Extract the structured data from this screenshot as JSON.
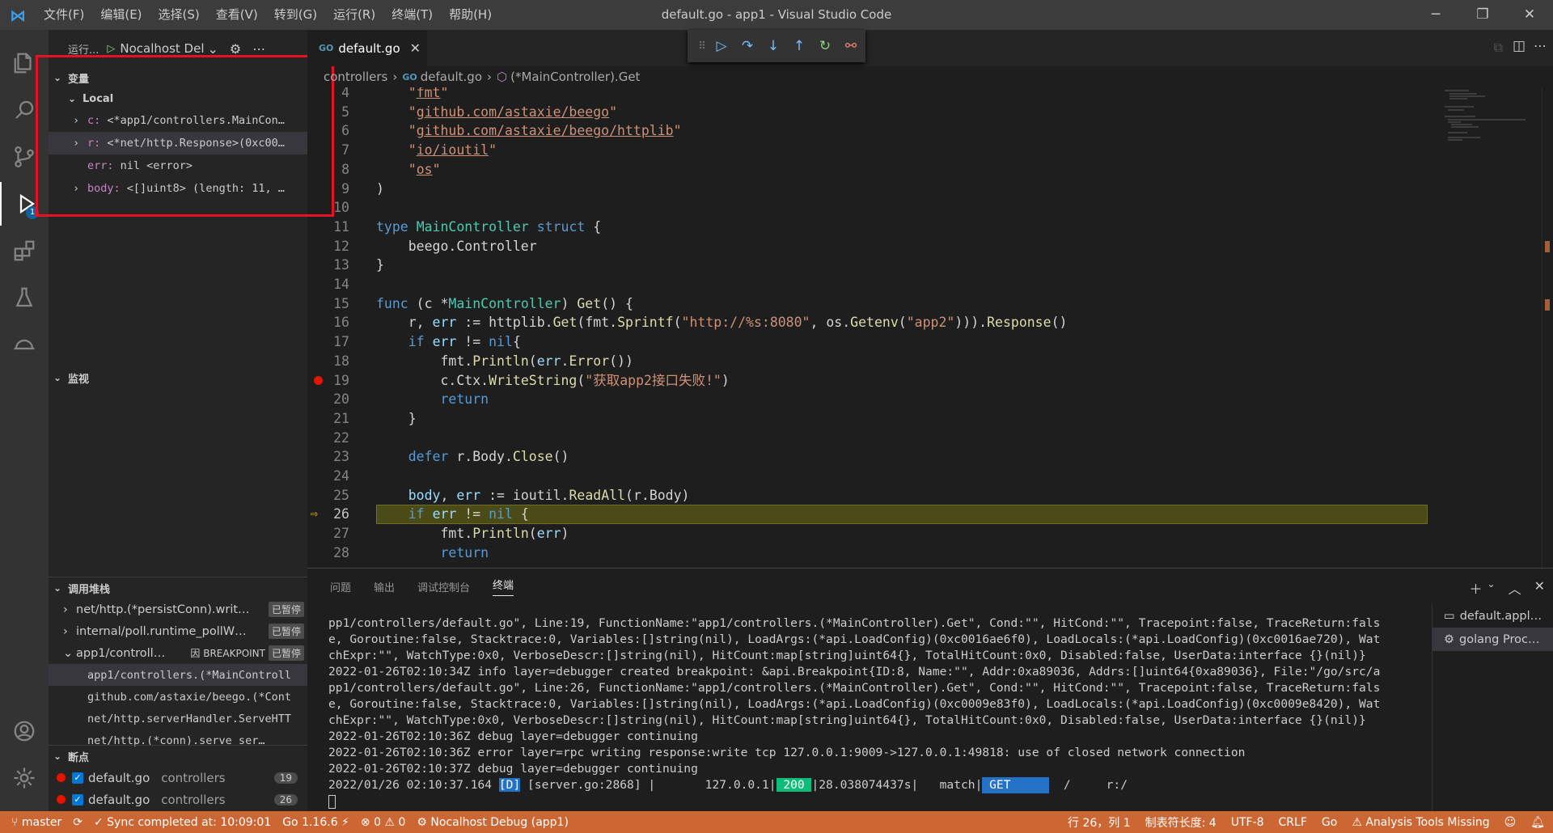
{
  "window": {
    "title": "default.go - app1 - Visual Studio Code",
    "menu": [
      "文件(F)",
      "编辑(E)",
      "选择(S)",
      "查看(V)",
      "转到(G)",
      "运行(R)",
      "终端(T)",
      "帮助(H)"
    ]
  },
  "activity": {
    "debug_badge": "1"
  },
  "debug_toolbar": {
    "run_label": "运行...",
    "config": "Nocalhost Del"
  },
  "variables": {
    "section_title": "变量",
    "scope": "Local",
    "items": [
      {
        "name": "c:",
        "value": "<*app1/controllers.MainCon…"
      },
      {
        "name": "r:",
        "value": "<*net/http.Response>(0xc00…"
      },
      {
        "name": "err:",
        "value": "nil <error>"
      },
      {
        "name": "body:",
        "value": "<[]uint8> (length: 11, …"
      }
    ]
  },
  "watch": {
    "section_title": "监视"
  },
  "callstack": {
    "section_title": "调用堆栈",
    "threads": [
      {
        "label": "net/http.(*persistConn).writ…",
        "status": "已暂停"
      },
      {
        "label": "internal/poll.runtime_pollW…",
        "status": "已暂停"
      },
      {
        "label": "app1/controll…",
        "reason": "因 BREAKPOINT",
        "status": "已暂停"
      }
    ],
    "frames": [
      "app1/controllers.(*MainControll",
      "github.com/astaxie/beego.(*Cont",
      "net/http.serverHandler.ServeHTT",
      "net/http.(*conn).serve   ser…"
    ]
  },
  "breakpoints": {
    "section_title": "断点",
    "items": [
      {
        "file": "default.go",
        "dir": "controllers",
        "line": "19"
      },
      {
        "file": "default.go",
        "dir": "controllers",
        "line": "26"
      }
    ]
  },
  "editor": {
    "tab": "default.go",
    "breadcrumb": {
      "folder": "controllers",
      "file": "default.go",
      "symbol": "(*MainController).Get"
    },
    "lines": [
      {
        "n": "4",
        "code": "    \"fmt\""
      },
      {
        "n": "5",
        "code": "    \"github.com/astaxie/beego\""
      },
      {
        "n": "6",
        "code": "    \"github.com/astaxie/beego/httplib\""
      },
      {
        "n": "7",
        "code": "    \"io/ioutil\""
      },
      {
        "n": "8",
        "code": "    \"os\""
      },
      {
        "n": "9",
        "code": ")"
      },
      {
        "n": "10",
        "code": ""
      },
      {
        "n": "11",
        "code": "type MainController struct {"
      },
      {
        "n": "12",
        "code": "    beego.Controller"
      },
      {
        "n": "13",
        "code": "}"
      },
      {
        "n": "14",
        "code": ""
      },
      {
        "n": "15",
        "code": "func (c *MainController) Get() {"
      },
      {
        "n": "16",
        "code": "    r, err := httplib.Get(fmt.Sprintf(\"http://%s:8080\", os.Getenv(\"app2\"))).Response()"
      },
      {
        "n": "17",
        "code": "    if err != nil{"
      },
      {
        "n": "18",
        "code": "        fmt.Println(err.Error())"
      },
      {
        "n": "19",
        "code": "        c.Ctx.WriteString(\"获取app2接口失败!\")"
      },
      {
        "n": "20",
        "code": "        return"
      },
      {
        "n": "21",
        "code": "    }"
      },
      {
        "n": "22",
        "code": ""
      },
      {
        "n": "23",
        "code": "    defer r.Body.Close()"
      },
      {
        "n": "24",
        "code": ""
      },
      {
        "n": "25",
        "code": "    body, err := ioutil.ReadAll(r.Body)"
      },
      {
        "n": "26",
        "code": "    if err != nil {"
      },
      {
        "n": "27",
        "code": "        fmt.Println(err)"
      },
      {
        "n": "28",
        "code": "        return"
      }
    ]
  },
  "panel": {
    "tabs": [
      "问题",
      "输出",
      "调试控制台",
      "终端"
    ],
    "active_tab": "终端",
    "terminals": [
      "default.appl…",
      "golang Proc…"
    ],
    "terminal_lines": [
      "pp1/controllers/default.go\", Line:19, FunctionName:\"app1/controllers.(*MainController).Get\", Cond:\"\", HitCond:\"\", Tracepoint:false, TraceReturn:fals",
      "e, Goroutine:false, Stacktrace:0, Variables:[]string(nil), LoadArgs:(*api.LoadConfig)(0xc0016ae6f0), LoadLocals:(*api.LoadConfig)(0xc0016ae720), Wat",
      "chExpr:\"\", WatchType:0x0, VerboseDescr:[]string(nil), HitCount:map[string]uint64{}, TotalHitCount:0x0, Disabled:false, UserData:interface {}(nil)}",
      "2022-01-26T02:10:34Z info layer=debugger created breakpoint: &api.Breakpoint{ID:8, Name:\"\", Addr:0xa89036, Addrs:[]uint64{0xa89036}, File:\"/go/src/a",
      "pp1/controllers/default.go\", Line:26, FunctionName:\"app1/controllers.(*MainController).Get\", Cond:\"\", HitCond:\"\", Tracepoint:false, TraceReturn:fals",
      "e, Goroutine:false, Stacktrace:0, Variables:[]string(nil), LoadArgs:(*api.LoadConfig)(0xc0009e83f0), LoadLocals:(*api.LoadConfig)(0xc0009e8420), Wat",
      "chExpr:\"\", WatchType:0x0, VerboseDescr:[]string(nil), HitCount:map[string]uint64{}, TotalHitCount:0x0, Disabled:false, UserData:interface {}(nil)}",
      "2022-01-26T02:10:36Z debug layer=debugger continuing",
      "2022-01-26T02:10:36Z error layer=rpc writing response:write tcp 127.0.0.1:9009->127.0.0.1:49818: use of closed network connection",
      "2022-01-26T02:10:37Z debug layer=debugger continuing"
    ],
    "log_line": {
      "date": "2022/01/26 02:10:37.164",
      "level": "[D]",
      "src": "[server.go:2868]",
      "ip": "127.0.0.1",
      "status": "200",
      "latency": "28.038074437s",
      "match": "match",
      "method": "GET",
      "path": "r:/"
    }
  },
  "statusbar": {
    "branch": "master",
    "sync": "Sync completed at: 10:09:01",
    "go_version": "Go 1.16.6",
    "problems": "0",
    "warnings": "0",
    "debug": "Nocalhost Debug (app1)",
    "position": "行 26，列 1",
    "tab_size": "制表符长度: 4",
    "encoding": "UTF-8",
    "eol": "CRLF",
    "language": "Go",
    "analysis": "Analysis Tools Missing"
  }
}
